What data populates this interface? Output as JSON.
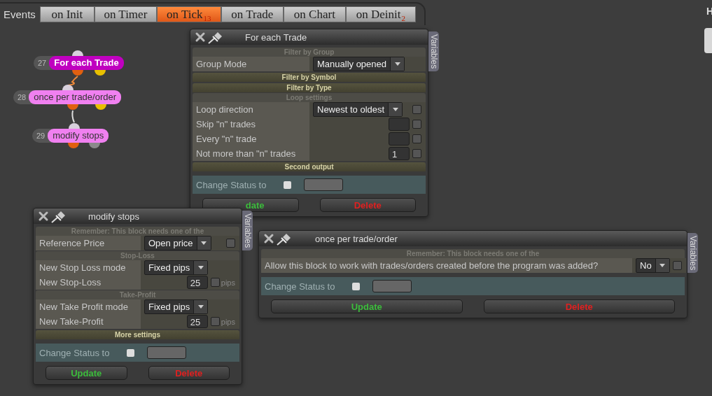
{
  "events_label": "Events",
  "tabs": [
    {
      "label": "on Init",
      "selected": false
    },
    {
      "label": "on Timer",
      "selected": false
    },
    {
      "label": "on Tick",
      "selected": true,
      "badge": "13"
    },
    {
      "label": "on Trade",
      "selected": false
    },
    {
      "label": "on Chart",
      "selected": false
    },
    {
      "label": "on Deinit",
      "selected": false,
      "badge": "2"
    }
  ],
  "corner_text": "H",
  "nodes": [
    {
      "number": "27",
      "label": "For each Trade",
      "selected": true
    },
    {
      "number": "28",
      "label": "once per trade/order",
      "selected": false
    },
    {
      "number": "29",
      "label": "modify stops",
      "selected": false
    }
  ],
  "windows": [
    {
      "title": "For each Trade",
      "side_tab": "Variables",
      "rows": [
        {
          "kind": "section",
          "label": "Filter by Group",
          "expanded": true
        },
        {
          "kind": "select",
          "label": "Group Mode",
          "value": "Manually opened"
        },
        {
          "kind": "section",
          "label": "Filter by Symbol",
          "expanded": false
        },
        {
          "kind": "section",
          "label": "Filter by Type",
          "expanded": false
        },
        {
          "kind": "section",
          "label": "Loop settings",
          "expanded": true
        },
        {
          "kind": "select",
          "label": "Loop direction",
          "value": "Newest to oldest",
          "checked": false
        },
        {
          "kind": "number",
          "label": "Skip \"n\" trades",
          "checked": false
        },
        {
          "kind": "number",
          "label": "Every \"n\" trade",
          "checked": false
        },
        {
          "kind": "number",
          "label": "Not more than \"n\" trades",
          "value": "1",
          "checked": false
        },
        {
          "kind": "section",
          "label": "Second output",
          "expanded": false
        }
      ],
      "status": {
        "label": "Change Status to",
        "checked": false
      },
      "buttons": [
        {
          "label": "date",
          "kind": "update"
        },
        {
          "label": "Delete",
          "kind": "delete"
        }
      ]
    },
    {
      "title": "modify stops",
      "side_tab": "Variables",
      "rows": [
        {
          "kind": "section",
          "label": "Remember: This block needs one of the",
          "expanded": true
        },
        {
          "kind": "select",
          "label": "Reference Price",
          "value": "Open price",
          "checked": false
        },
        {
          "kind": "section",
          "label": "Stop-Loss",
          "expanded": true
        },
        {
          "kind": "select",
          "label": "New Stop Loss mode",
          "value": "Fixed pips"
        },
        {
          "kind": "number",
          "label": "New Stop-Loss",
          "value": "25",
          "checked": false,
          "unit": "pips"
        },
        {
          "kind": "section",
          "label": "Take-Profit",
          "expanded": true
        },
        {
          "kind": "select",
          "label": "New Take Profit mode",
          "value": "Fixed pips"
        },
        {
          "kind": "number",
          "label": "New Take-Profit",
          "value": "25",
          "checked": false,
          "unit": "pips"
        },
        {
          "kind": "section",
          "label": "More settings",
          "expanded": false
        }
      ],
      "status": {
        "label": "Change Status to",
        "checked": false
      },
      "buttons": [
        {
          "label": "Update",
          "kind": "update"
        },
        {
          "label": "Delete",
          "kind": "delete"
        }
      ]
    },
    {
      "title": "once per trade/order",
      "side_tab": "Variables",
      "rows": [
        {
          "kind": "section",
          "label": "Remember: This block needs one of the",
          "expanded": true
        },
        {
          "kind": "select",
          "label": "Allow this block to work with trades/orders created before the program was added?",
          "value": "No",
          "checked": false
        }
      ],
      "status": {
        "label": "Change Status to",
        "checked": false
      },
      "buttons": [
        {
          "label": "Update",
          "kind": "update"
        },
        {
          "label": "Delete",
          "kind": "delete"
        }
      ]
    }
  ]
}
